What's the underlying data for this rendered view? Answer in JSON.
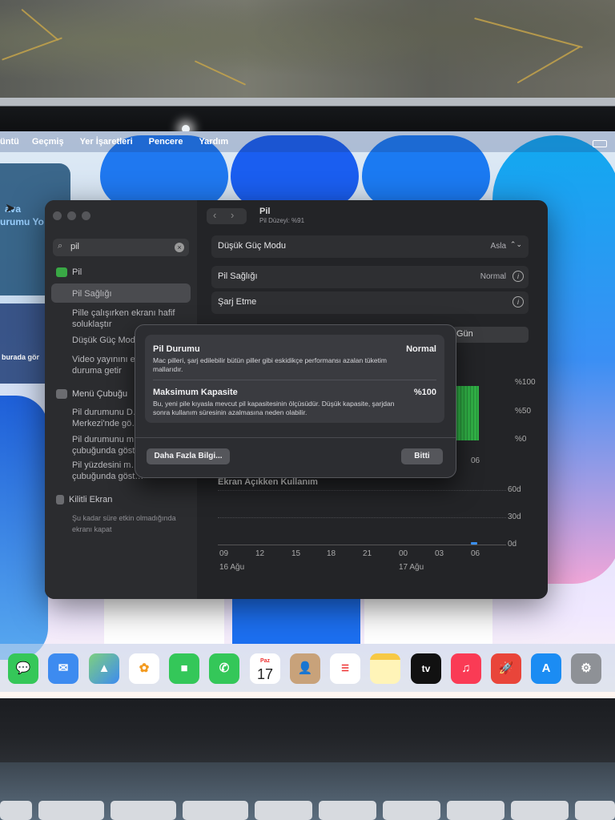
{
  "menubar": {
    "items": [
      "üntü",
      "Geçmiş",
      "Yer İşaretleri",
      "Pencere",
      "Yardım"
    ]
  },
  "widget": {
    "line1": "ava",
    "line2": "urumu Yo",
    "strip_text": "burada gör"
  },
  "window": {
    "title": "Pil",
    "subtitle": "Pil Düzeyi: %91",
    "search": {
      "value": "pil",
      "clear_icon": "clear-icon"
    },
    "sidebar": {
      "section_pil": "Pil",
      "items_pil": [
        "Pil Sağlığı",
        "Pille çalışırken ekranı hafif soluklaştır",
        "Düşük Güç Modu",
        "Video yayınını en iyi duruma getir"
      ],
      "section_menu": "Menü Çubuğu",
      "items_menu": [
        "Pil durumunu D… Merkezi'nde gö…",
        "Pil durumunu m… çubuğunda göst…",
        "Pil yüzdesini m… çubuğunda göst…"
      ],
      "section_lock": "Kilitli Ekran",
      "items_lock": [
        "Şu kadar süre etkin olmadığında ekranı kapat"
      ]
    },
    "rows": {
      "low_power_label": "Düşük Güç Modu",
      "low_power_value": "Asla",
      "health_label": "Pil Sağlığı",
      "health_value": "Normal",
      "charging_label": "Şarj Etme"
    },
    "range_segment": "Gün",
    "level_chart": {
      "y_ticks": [
        "%100",
        "%50",
        "%0"
      ],
      "x_tick": "06"
    },
    "usage": {
      "title": "Ekran Açıkken Kullanım",
      "y_ticks": [
        "60d",
        "30d",
        "0d"
      ],
      "x_ticks": [
        "09",
        "12",
        "15",
        "18",
        "21",
        "00",
        "03",
        "06"
      ],
      "day1": "16 Ağu",
      "day2": "17 Ağu"
    }
  },
  "dialog": {
    "status_title": "Pil Durumu",
    "status_value": "Normal",
    "status_desc": "Mac pilleri, şarj edilebilir bütün piller gibi eskidikçe performansı azalan tüketim mallarıdır.",
    "capacity_title": "Maksimum Kapasite",
    "capacity_value": "%100",
    "capacity_desc": "Bu, yeni pile kıyasla mevcut pil kapasitesinin ölçüsüdür. Düşük kapasite, şarjdan sonra kullanım süresinin azalmasına neden olabilir.",
    "more_info_button": "Daha Fazla Bilgi...",
    "done_button": "Bitti"
  },
  "dock": {
    "apps": [
      {
        "name": "messages-icon",
        "color": "#35c759"
      },
      {
        "name": "mail-icon",
        "color": "#3d8bf0"
      },
      {
        "name": "maps-icon",
        "color": "#5fb86b"
      },
      {
        "name": "photos-icon",
        "color": "#ffffff"
      },
      {
        "name": "facetime-icon",
        "color": "#34c759"
      },
      {
        "name": "phone-icon",
        "color": "#34c759"
      },
      {
        "name": "calendar-icon",
        "color": "#ffffff"
      },
      {
        "name": "contacts-icon",
        "color": "#c8a27a"
      },
      {
        "name": "reminders-icon",
        "color": "#ffffff"
      },
      {
        "name": "notes-icon",
        "color": "#fff4b8"
      },
      {
        "name": "appletv-icon",
        "color": "#111111"
      },
      {
        "name": "music-icon",
        "color": "#fa3b55"
      },
      {
        "name": "launchpad-icon",
        "color": "#e9453a"
      },
      {
        "name": "appstore-icon",
        "color": "#1b8cf3"
      },
      {
        "name": "system-settings-icon",
        "color": "#8e9196"
      }
    ],
    "calendar_month": "Paz",
    "calendar_day": "17",
    "tv_label": "tv"
  }
}
